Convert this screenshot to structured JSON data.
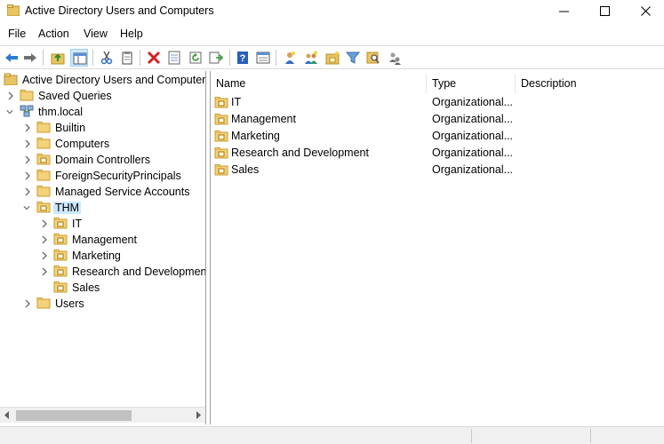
{
  "window": {
    "title": "Active Directory Users and Computers"
  },
  "menu": [
    {
      "label": "File"
    },
    {
      "label": "Action"
    },
    {
      "label": "View"
    },
    {
      "label": "Help"
    }
  ],
  "toolbar": {
    "buttons": [
      {
        "icon": "back-arrow-icon"
      },
      {
        "icon": "forward-arrow-icon"
      },
      {
        "icon": "up-folder-icon"
      },
      {
        "icon": "show-hide-tree-icon"
      },
      {
        "icon": "cut-icon"
      },
      {
        "icon": "copy-icon"
      },
      {
        "icon": "delete-icon"
      },
      {
        "icon": "properties-icon"
      },
      {
        "icon": "refresh-icon"
      },
      {
        "icon": "export-list-icon"
      },
      {
        "icon": "help-icon"
      },
      {
        "icon": "console-view-icon"
      },
      {
        "icon": "new-user-icon"
      },
      {
        "icon": "new-group-icon"
      },
      {
        "icon": "new-ou-icon"
      },
      {
        "icon": "filter-icon"
      },
      {
        "icon": "find-icon"
      },
      {
        "icon": "add-to-group-icon"
      }
    ]
  },
  "tree": {
    "root_label": "Active Directory Users and Computers [",
    "saved_queries": "Saved Queries",
    "domain": "thm.local",
    "domain_children": [
      {
        "label": "Builtin",
        "kind": "container"
      },
      {
        "label": "Computers",
        "kind": "container"
      },
      {
        "label": "Domain Controllers",
        "kind": "ou"
      },
      {
        "label": "ForeignSecurityPrincipals",
        "kind": "container"
      },
      {
        "label": "Managed Service Accounts",
        "kind": "container"
      }
    ],
    "selected_ou": "THM",
    "thm_children": [
      {
        "label": "IT",
        "expandable": true
      },
      {
        "label": "Management",
        "expandable": true
      },
      {
        "label": "Marketing",
        "expandable": true
      },
      {
        "label": "Research and Development",
        "expandable": true
      },
      {
        "label": "Sales",
        "expandable": false
      }
    ],
    "users": "Users"
  },
  "list": {
    "columns": {
      "name": "Name",
      "type": "Type",
      "description": "Description"
    },
    "rows": [
      {
        "name": "IT",
        "type": "Organizational...",
        "description": ""
      },
      {
        "name": "Management",
        "type": "Organizational...",
        "description": ""
      },
      {
        "name": "Marketing",
        "type": "Organizational...",
        "description": ""
      },
      {
        "name": "Research and Development",
        "type": "Organizational...",
        "description": ""
      },
      {
        "name": "Sales",
        "type": "Organizational...",
        "description": ""
      }
    ]
  },
  "colors": {
    "selection": "#cce8ff",
    "folder": "#e8c462",
    "folder_dark": "#c89b2c"
  }
}
